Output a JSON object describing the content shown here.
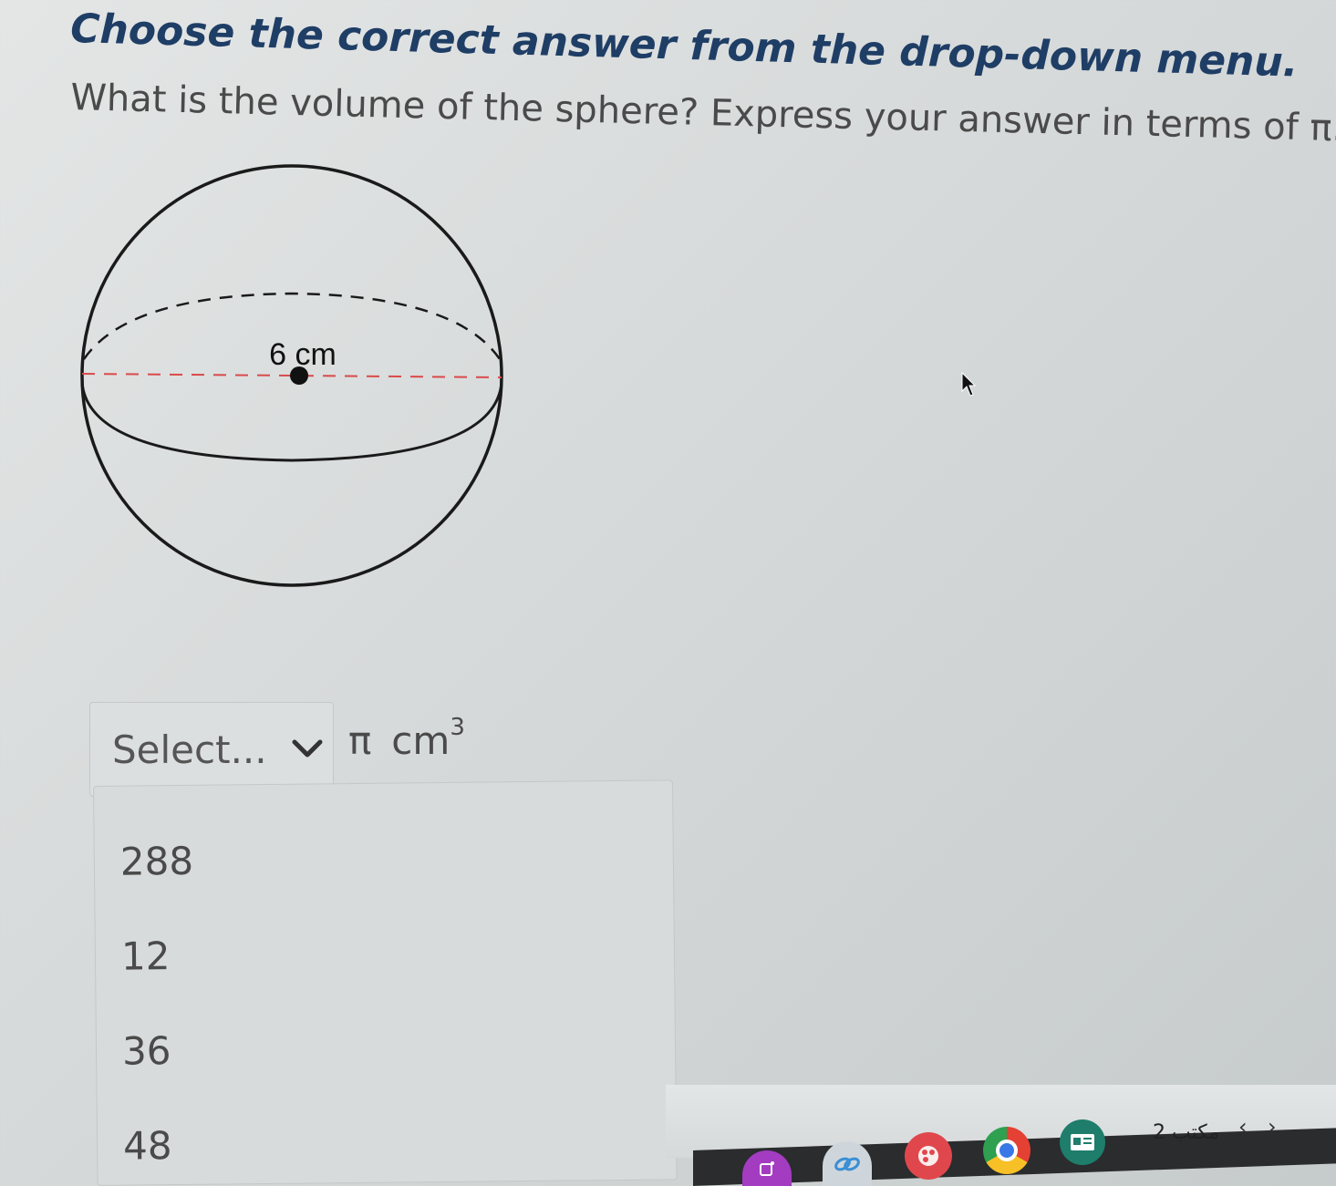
{
  "instruction": "Choose the correct answer from the drop-down menu.",
  "question": "What is the volume of the sphere? Express your answer in terms of π.",
  "figure": {
    "radius_label": "6 cm"
  },
  "answer": {
    "select_placeholder": "Select...",
    "unit_pi": "π",
    "unit_cm": "cm",
    "unit_exp": "3"
  },
  "options": [
    "288",
    "12",
    "36",
    "48"
  ],
  "taskbar": {
    "desk_label": "2 مكتب",
    "prev": "‹",
    "next": "›",
    "colors": {
      "launcher": "#a33cc0",
      "paint": "#e0474c",
      "chrome_red": "#e44134",
      "chrome_yellow": "#f6c026",
      "chrome_green": "#2ea04f",
      "chrome_blue": "#3b78e7",
      "classroom": "#1e7d6b"
    },
    "icons": [
      "launcher-icon",
      "link-app-icon",
      "paint-icon",
      "chrome-icon",
      "classroom-icon"
    ]
  },
  "colors": {
    "instruction": "#1f3e66",
    "radius_line": "#d94a4a"
  }
}
